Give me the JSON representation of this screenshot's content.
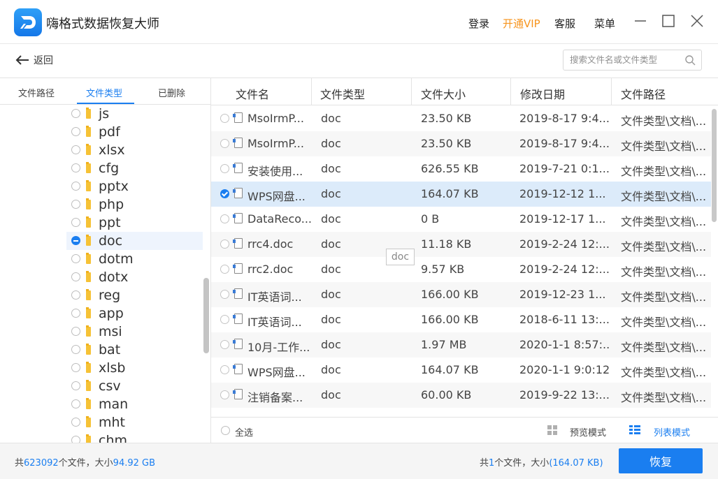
{
  "app": {
    "title": "嗨格式数据恢复大师"
  },
  "header": {
    "login": "登录",
    "vip": "开通VIP",
    "service": "客服",
    "menu": "菜单"
  },
  "nav": {
    "back": "返回",
    "search_placeholder": "搜索文件名或文件类型"
  },
  "left_tabs": [
    "文件路径",
    "文件类型",
    "已删除"
  ],
  "tree": [
    {
      "label": "js",
      "state": "unchecked"
    },
    {
      "label": "pdf",
      "state": "unchecked"
    },
    {
      "label": "xlsx",
      "state": "unchecked"
    },
    {
      "label": "cfg",
      "state": "unchecked"
    },
    {
      "label": "pptx",
      "state": "unchecked"
    },
    {
      "label": "php",
      "state": "unchecked"
    },
    {
      "label": "ppt",
      "state": "unchecked"
    },
    {
      "label": "doc",
      "state": "partial"
    },
    {
      "label": "dotm",
      "state": "unchecked"
    },
    {
      "label": "dotx",
      "state": "unchecked"
    },
    {
      "label": "reg",
      "state": "unchecked"
    },
    {
      "label": "app",
      "state": "unchecked"
    },
    {
      "label": "msi",
      "state": "unchecked"
    },
    {
      "label": "bat",
      "state": "unchecked"
    },
    {
      "label": "xlsb",
      "state": "unchecked"
    },
    {
      "label": "csv",
      "state": "unchecked"
    },
    {
      "label": "man",
      "state": "unchecked"
    },
    {
      "label": "mht",
      "state": "unchecked"
    },
    {
      "label": "chm",
      "state": "unchecked"
    }
  ],
  "table": {
    "columns": [
      "文件名",
      "文件类型",
      "文件大小",
      "修改日期",
      "文件路径"
    ],
    "rows": [
      {
        "name": "MsoIrmP...",
        "type": "doc",
        "size": "23.50 KB",
        "date": "2019-8-17 9:4...",
        "path": "文件类型\\文档\\...",
        "checked": false
      },
      {
        "name": "MsoIrmP...",
        "type": "doc",
        "size": "23.50 KB",
        "date": "2019-8-17 9:4...",
        "path": "文件类型\\文档\\...",
        "checked": false
      },
      {
        "name": "安装使用...",
        "type": "doc",
        "size": "626.55 KB",
        "date": "2019-7-21 0:1...",
        "path": "文件类型\\文档\\...",
        "checked": false
      },
      {
        "name": "WPS网盘...",
        "type": "doc",
        "size": "164.07 KB",
        "date": "2019-12-12 1...",
        "path": "文件类型\\文档\\...",
        "checked": true
      },
      {
        "name": "DataReco...",
        "type": "doc",
        "size": "0 B",
        "date": "2019-12-17 1...",
        "path": "文件类型\\文档\\...",
        "checked": false
      },
      {
        "name": "rrc4.doc",
        "type": "doc",
        "size": "11.18 KB",
        "date": "2019-2-24 12:...",
        "path": "文件类型\\文档\\...",
        "checked": false
      },
      {
        "name": "rrc2.doc",
        "type": "doc",
        "size": "9.57 KB",
        "date": "2019-2-24 12:...",
        "path": "文件类型\\文档\\...",
        "checked": false
      },
      {
        "name": "IT英语词...",
        "type": "doc",
        "size": "166.00 KB",
        "date": "2019-12-23 1...",
        "path": "文件类型\\文档\\...",
        "checked": false
      },
      {
        "name": "IT英语词...",
        "type": "doc",
        "size": "166.00 KB",
        "date": "2018-6-11 13:...",
        "path": "文件类型\\文档\\...",
        "checked": false
      },
      {
        "name": "10月-工作...",
        "type": "doc",
        "size": "1.97 MB",
        "date": "2020-1-1 8:57:...",
        "path": "文件类型\\文档\\...",
        "checked": false
      },
      {
        "name": "WPS网盘...",
        "type": "doc",
        "size": "164.07 KB",
        "date": "2020-1-1 9:0:12",
        "path": "文件类型\\文档\\...",
        "checked": false
      },
      {
        "name": "注销备案...",
        "type": "doc",
        "size": "60.00 KB",
        "date": "2019-9-22 13:...",
        "path": "文件类型\\文档\\...",
        "checked": false
      }
    ],
    "tooltip": "doc"
  },
  "footer": {
    "select_all": "全选",
    "preview_mode": "预览模式",
    "list_mode": "列表模式"
  },
  "status": {
    "total_prefix": "共",
    "total_count": "623092",
    "total_mid": "个文件，大小",
    "total_size": "94.92 GB",
    "sel_prefix": "共",
    "sel_count": "1",
    "sel_mid": "个文件，大小",
    "sel_size": "(164.07 KB)",
    "recover": "恢复"
  },
  "colors": {
    "accent": "#1a7ef0",
    "vip": "#f7941d",
    "selected_row": "#dcebfa"
  }
}
